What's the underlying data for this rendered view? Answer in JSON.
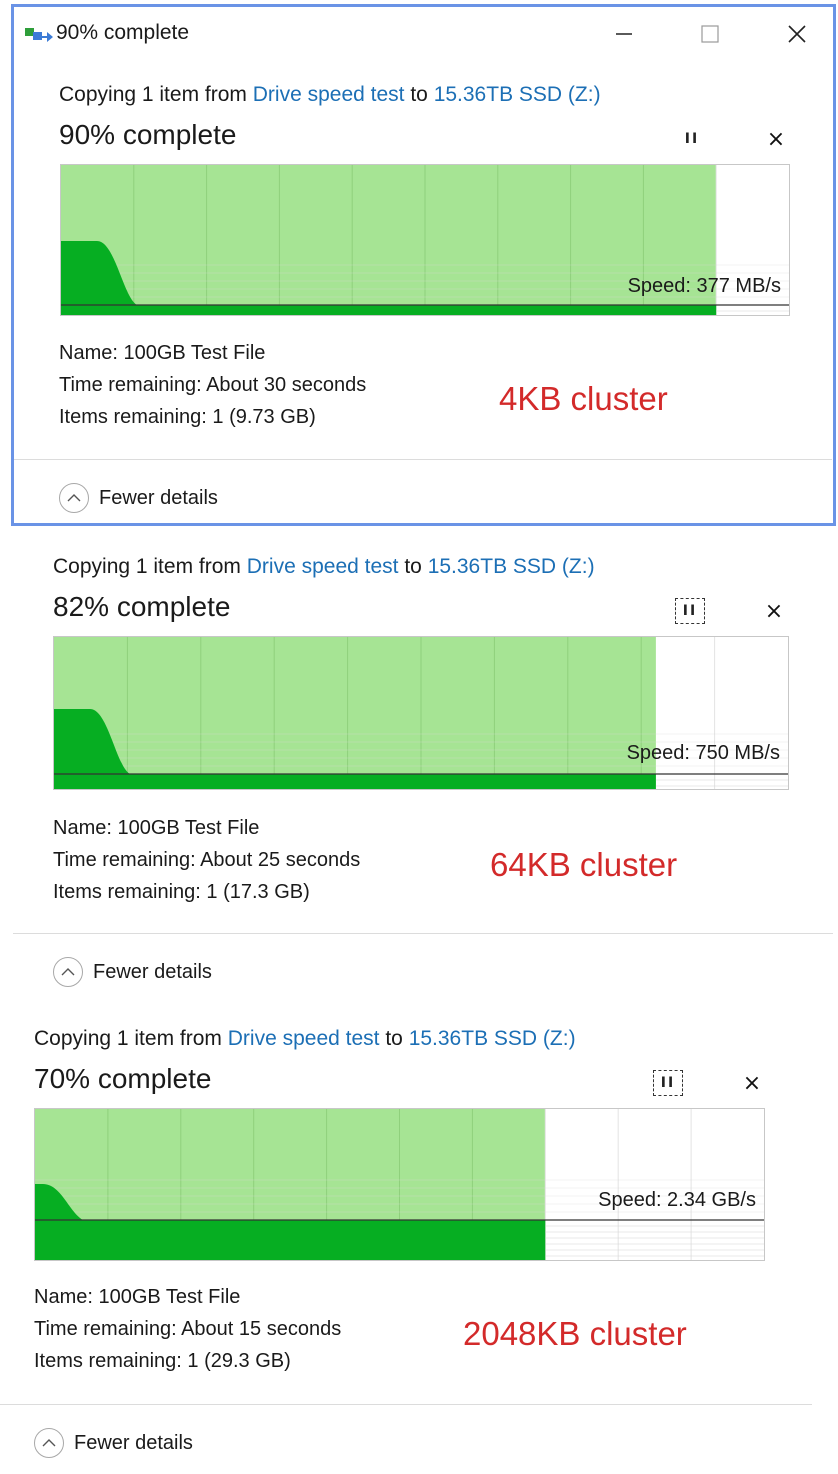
{
  "window": {
    "title": "90% complete",
    "icons": {
      "app": "copy-files-icon",
      "minimize": "minimize-icon",
      "maximize": "maximize-icon",
      "close": "close-icon"
    }
  },
  "colors": {
    "accent_link": "#1c6fb5",
    "progress_fill": "#a6e494",
    "speed_area": "#06ae22",
    "annotation": "#d32a2a",
    "window_border": "#6a93e6"
  },
  "panels": [
    {
      "copy_prefix": "Copying 1 item from ",
      "source": "Drive speed test",
      "to_word": " to ",
      "destination": "15.36TB SSD (Z:)",
      "percent_text": "90% complete",
      "progress": 0.9,
      "speed_text": "Speed: 377 MB/s",
      "name_text": "Name:  100GB Test File",
      "time_text": "Time remaining:  About 30 seconds",
      "items_text": "Items remaining:  1 (9.73 GB)",
      "cluster_text": "4KB cluster",
      "fewer_text": "Fewer details",
      "pause_icon": "pause-icon",
      "cancel_icon": "cancel-icon"
    },
    {
      "copy_prefix": "Copying 1 item from ",
      "source": "Drive speed test",
      "to_word": " to ",
      "destination": "15.36TB SSD (Z:)",
      "percent_text": "82% complete",
      "progress": 0.82,
      "speed_text": "Speed: 750 MB/s",
      "name_text": "Name:  100GB Test File",
      "time_text": "Time remaining:  About 25 seconds",
      "items_text": "Items remaining:  1 (17.3 GB)",
      "cluster_text": "64KB cluster",
      "fewer_text": "Fewer details",
      "pause_icon": "pause-icon",
      "cancel_icon": "cancel-icon"
    },
    {
      "copy_prefix": "Copying 1 item from ",
      "source": "Drive speed test",
      "to_word": " to ",
      "destination": "15.36TB SSD (Z:)",
      "percent_text": "70% complete",
      "progress": 0.7,
      "speed_text": "Speed: 2.34 GB/s",
      "name_text": "Name:  100GB Test File",
      "time_text": "Time remaining:  About 15 seconds",
      "items_text": "Items remaining:  1 (29.3 GB)",
      "cluster_text": "2048KB cluster",
      "fewer_text": "Fewer details",
      "pause_icon": "pause-icon",
      "cancel_icon": "cancel-icon"
    }
  ]
}
